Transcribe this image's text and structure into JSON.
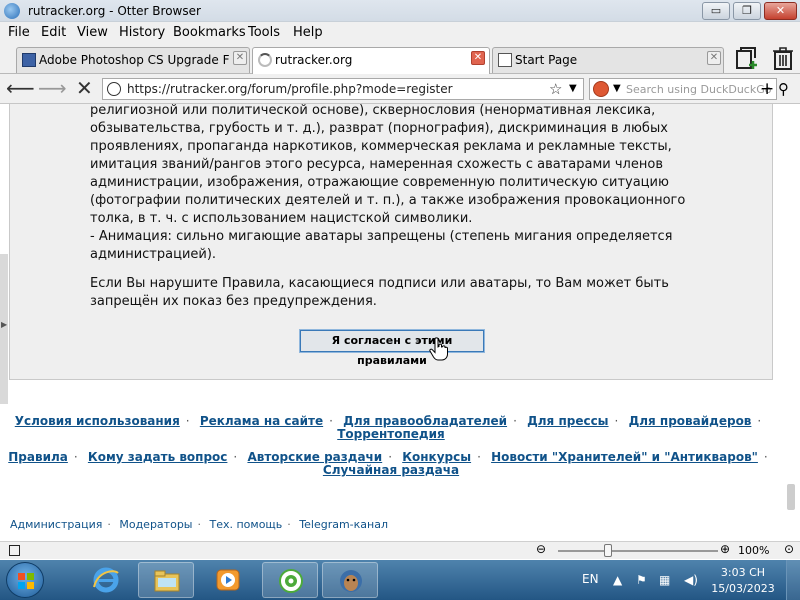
{
  "window": {
    "title": "rutracker.org - Otter Browser",
    "minimize_glyph": "▭",
    "maximize_glyph": "❐",
    "close_glyph": "✕"
  },
  "menu": [
    "File",
    "Edit",
    "View",
    "History",
    "Bookmarks",
    "Tools",
    "Help"
  ],
  "tabs": [
    {
      "label": "Adobe Photoshop CS Upgrade For Wi...",
      "icon": "photoshop-icon",
      "active": false
    },
    {
      "label": "rutracker.org",
      "icon": "loading-spinner-icon",
      "active": true
    },
    {
      "label": "Start Page",
      "icon": "page-icon",
      "active": false
    }
  ],
  "tab_close_glyph": "✕",
  "navigation": {
    "back_glyph": "⟵",
    "forward_glyph": "⟶",
    "stop_glyph": "✕",
    "url": "https://rutracker.org/forum/profile.php?mode=register",
    "bookmark_glyph": "☆",
    "dropdown_glyph": "▼",
    "search_placeholder": "Search using DuckDuckGo",
    "search_add_glyph": "+",
    "search_glyph": "⚲"
  },
  "page": {
    "rules_lines": [
      "религиозной или политической основе), сквернословия (ненормативная лексика,",
      "обзывательства, грубость и т. д.), разврат (порнография), дискриминация в любых",
      "проявлениях, пропаганда наркотиков, коммерческая реклама и рекламные тексты,",
      "имитация званий/рангов этого ресурса, намеренная схожесть с аватарами членов",
      "администрации, изображения, отражающие современную политическую ситуацию",
      "(фотографии политических деятелей и т. п.), а также изображения провокационного",
      "толка, в т. ч. с использованием нацистской символики.",
      "- Анимация: сильно мигающие аватары запрещены (степень мигания определяется",
      "администрацией)."
    ],
    "warning_lines": [
      "Если Вы нарушите Правила, касающиеся подписи или аватары, то Вам может быть",
      "запрещён их показ без предупреждения."
    ],
    "agree_button": "Я согласен с этими правилами",
    "footer_row1": [
      "Условия использования",
      "Реклама на сайте",
      "Для правообладателей",
      "Для прессы",
      "Для провайдеров"
    ],
    "footer_row1b": "Торрентопедия",
    "footer_row2": [
      "Правила",
      "Кому задать вопрос",
      "Авторские раздачи",
      "Конкурсы",
      "Новости \"Хранителей\" и \"Антикваров\""
    ],
    "footer_row2b": "Случайная раздача",
    "footer_small": [
      "Администрация",
      "Модераторы",
      "Тех. помощь",
      "Telegram-канал"
    ],
    "separator": "·"
  },
  "statusbar": {
    "zoom_out_glyph": "⊖",
    "zoom_in_glyph": "⊕",
    "zoom_level": 100
  },
  "taskbar": {
    "apps": [
      "internet-explorer-icon",
      "file-explorer-icon",
      "media-player-icon",
      "coccoc-browser-icon",
      "otter-browser-icon"
    ],
    "language": "EN",
    "time": "3:03 CH",
    "date": "15/03/2023"
  }
}
